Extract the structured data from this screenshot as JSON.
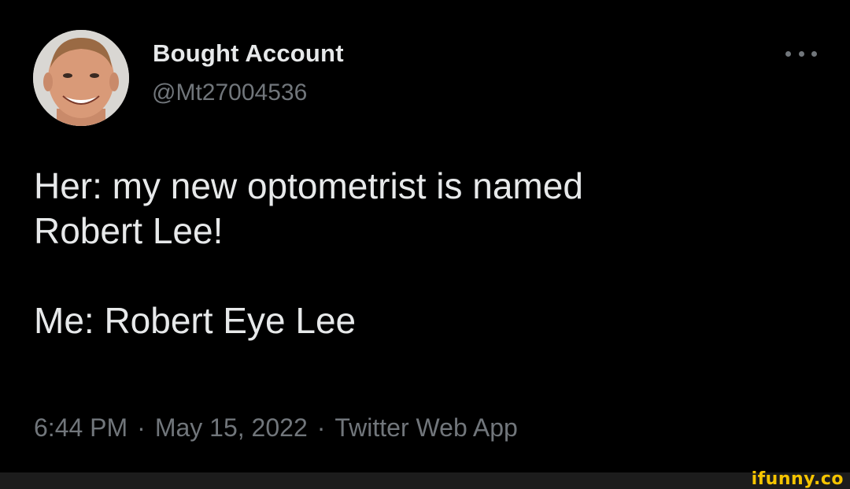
{
  "tweet": {
    "author": {
      "display_name": "Bought Account",
      "handle": "@Mt27004536",
      "avatar_icon": "profile-photo"
    },
    "more_icon": "more-dots-icon",
    "text": {
      "line1": "Her: my new optometrist is named",
      "line2": "Robert Lee!",
      "line3": "Me: Robert Eye Lee"
    },
    "meta": {
      "time": "6:44 PM",
      "separator": "·",
      "date": "May 15, 2022",
      "source": "Twitter Web App"
    }
  },
  "watermark": {
    "text": "ifunny.co",
    "color": "#f5c400"
  },
  "colors": {
    "background": "#000000",
    "primary_text": "#e7e9ea",
    "secondary_text": "#71767b"
  }
}
